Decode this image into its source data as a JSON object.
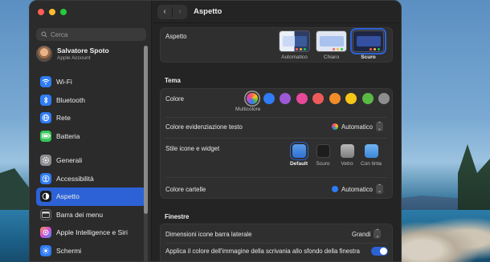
{
  "window": {
    "title": "Aspetto"
  },
  "sidebar": {
    "search_placeholder": "Cerca",
    "account": {
      "name": "Salvatore Spoto",
      "subtitle": "Apple Account"
    },
    "items": [
      {
        "label": "Wi-Fi",
        "icon": "wifi-icon",
        "color": "#2f7cf6"
      },
      {
        "label": "Bluetooth",
        "icon": "bluetooth-icon",
        "color": "#2f7cf6"
      },
      {
        "label": "Rete",
        "icon": "network-icon",
        "color": "#2f7cf6"
      },
      {
        "label": "Batteria",
        "icon": "battery-icon",
        "color": "#34c759"
      },
      {
        "label": "Generali",
        "icon": "gear-icon",
        "color": "#8e8e93"
      },
      {
        "label": "Accessibilità",
        "icon": "accessibility-icon",
        "color": "#2f7cf6"
      },
      {
        "label": "Aspetto",
        "icon": "appearance-icon",
        "color": "#1c1c1e"
      },
      {
        "label": "Barra dei menu",
        "icon": "menubar-icon",
        "color": "#2b2b2b"
      },
      {
        "label": "Apple Intelligence e Siri",
        "icon": "siri-icon",
        "color": "#c04bd8"
      },
      {
        "label": "Schermi",
        "icon": "display-icon",
        "color": "#2f7cf6"
      }
    ]
  },
  "appearance": {
    "label": "Aspetto",
    "options": [
      {
        "label": "Automatico",
        "selected": false
      },
      {
        "label": "Chiaro",
        "selected": false
      },
      {
        "label": "Scuro",
        "selected": true
      }
    ]
  },
  "tema": {
    "heading": "Tema",
    "colore_label": "Colore",
    "multicolor_label": "Multicolore",
    "swatches": [
      "multicolor",
      "#2f7cf6",
      "#9b59d6",
      "#e6489a",
      "#ee5a5a",
      "#f28c28",
      "#f5c518",
      "#5ab844",
      "#8e8e8e"
    ],
    "highlight_label": "Colore evidenziazione testo",
    "highlight_value": "Automatico",
    "icon_style_label": "Stile icone e widget",
    "icon_styles": [
      {
        "label": "Default",
        "selected": true
      },
      {
        "label": "Scuro",
        "selected": false
      },
      {
        "label": "Vetro",
        "selected": false
      },
      {
        "label": "Con tinta",
        "selected": false
      }
    ],
    "folder_color_label": "Colore cartelle",
    "folder_color_value": "Automatico"
  },
  "finestre": {
    "heading": "Finestre",
    "sidebar_icon_label": "Dimensioni icone barra laterale",
    "sidebar_icon_value": "Grandi",
    "wallpaper_tint_label": "Applica il colore dell'immagine della scrivania allo sfondo della finestra",
    "wallpaper_tint_on": true
  }
}
